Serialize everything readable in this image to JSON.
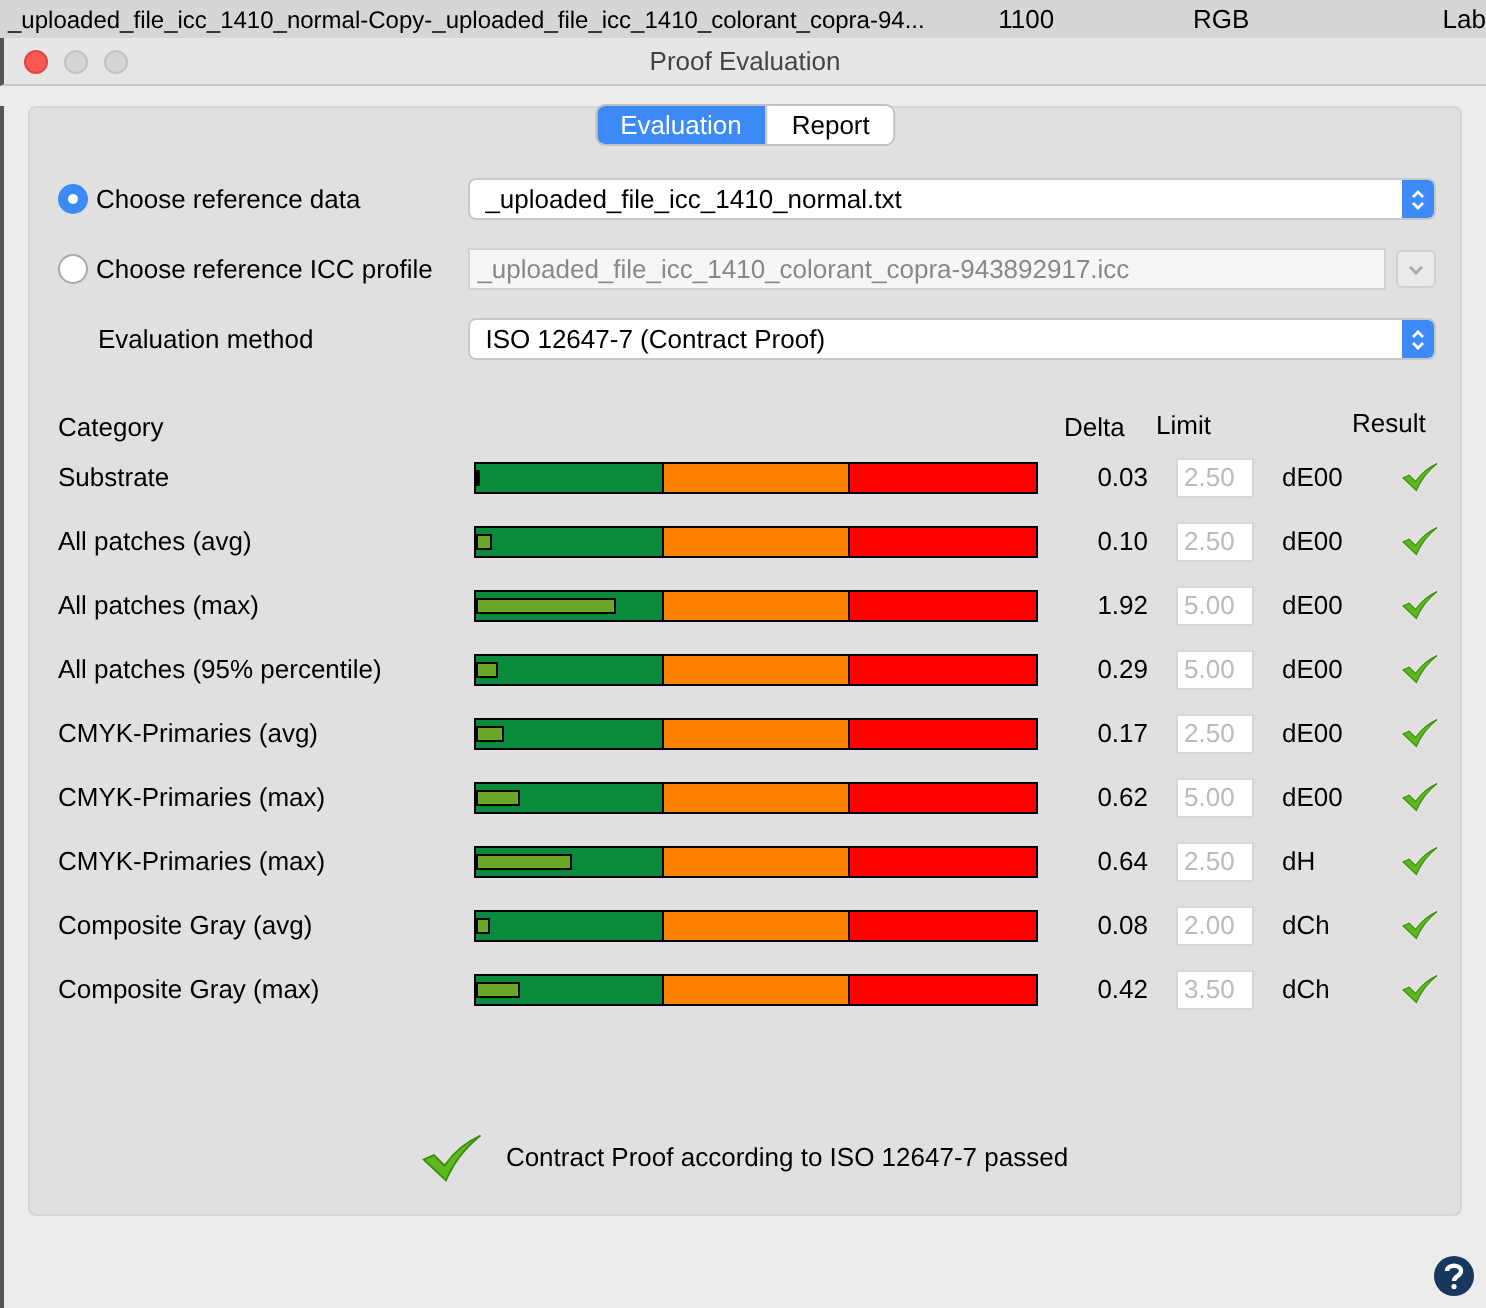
{
  "background_row": [
    "_uploaded_file_icc_1410_normal-Copy-_uploaded_file_icc_1410_colorant_copra-94...",
    "1100",
    "RGB",
    "Lab"
  ],
  "window": {
    "title": "Proof Evaluation"
  },
  "tabs": [
    {
      "label": "Evaluation",
      "selected": true
    },
    {
      "label": "Report",
      "selected": false
    }
  ],
  "reference": [
    {
      "label": "Choose reference data",
      "selected": true,
      "value": "_uploaded_file_icc_1410_normal.txt",
      "disabled": false
    },
    {
      "label": "Choose reference ICC profile",
      "selected": false,
      "value": "_uploaded_file_icc_1410_colorant_copra-943892917.icc",
      "disabled": true
    }
  ],
  "evaluation_method": {
    "label": "Evaluation method",
    "value": "ISO 12647-7 (Contract Proof)"
  },
  "table": {
    "columns": [
      "Category",
      "Delta",
      "Limit",
      "Result"
    ],
    "rows": [
      {
        "category": "Substrate",
        "level": 0.005,
        "delta": "0.03",
        "limit": "2.50",
        "unit": "dE00",
        "passed": true
      },
      {
        "category": "All patches (avg)",
        "level": 0.03,
        "delta": "0.10",
        "limit": "2.50",
        "unit": "dE00",
        "passed": true
      },
      {
        "category": "All patches (max)",
        "level": 0.25,
        "delta": "1.92",
        "limit": "5.00",
        "unit": "dE00",
        "passed": true
      },
      {
        "category": "All patches (95% percentile)",
        "level": 0.04,
        "delta": "0.29",
        "limit": "5.00",
        "unit": "dE00",
        "passed": true
      },
      {
        "category": "CMYK-Primaries (avg)",
        "level": 0.05,
        "delta": "0.17",
        "limit": "2.50",
        "unit": "dE00",
        "passed": true
      },
      {
        "category": "CMYK-Primaries (max)",
        "level": 0.08,
        "delta": "0.62",
        "limit": "5.00",
        "unit": "dE00",
        "passed": true
      },
      {
        "category": "CMYK-Primaries (max)",
        "level": 0.17,
        "delta": "0.64",
        "limit": "2.50",
        "unit": "dH",
        "passed": true
      },
      {
        "category": "Composite Gray (avg)",
        "level": 0.025,
        "delta": "0.08",
        "limit": "2.00",
        "unit": "dCh",
        "passed": true
      },
      {
        "category": "Composite Gray (max)",
        "level": 0.08,
        "delta": "0.42",
        "limit": "3.50",
        "unit": "dCh",
        "passed": true
      }
    ]
  },
  "summary": {
    "text": "Contract Proof according to ISO 12647-7 passed",
    "passed": true
  }
}
